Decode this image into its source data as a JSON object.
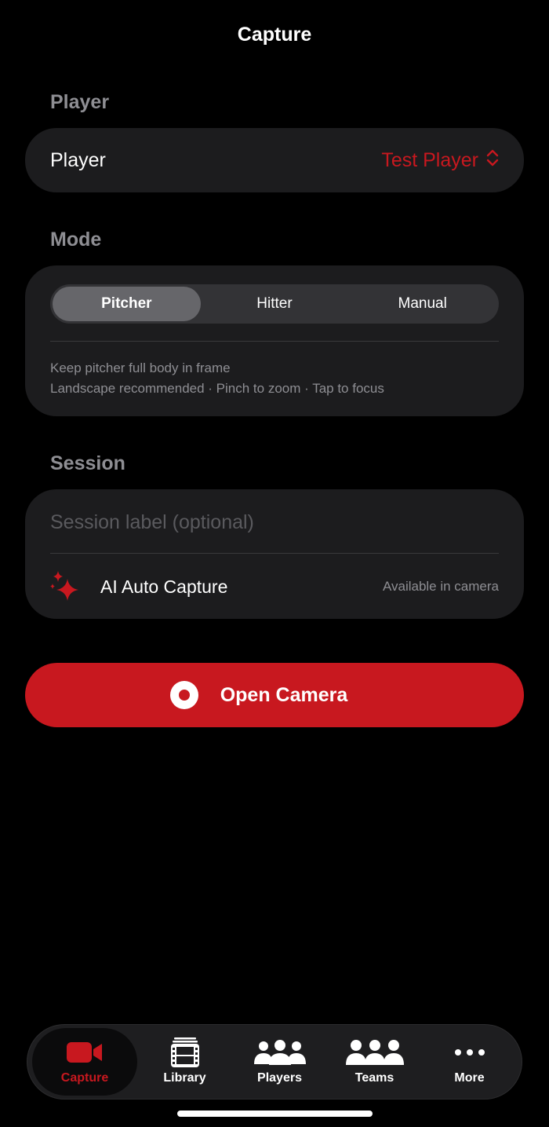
{
  "header": {
    "title": "Capture"
  },
  "player_section": {
    "header": "Player",
    "row_label": "Player",
    "selected_player": "Test Player"
  },
  "mode_section": {
    "header": "Mode",
    "segments": [
      "Pitcher",
      "Hitter",
      "Manual"
    ],
    "selected": "Pitcher",
    "hint_line_1": "Keep pitcher full body in frame",
    "hint_line_2": "Landscape recommended · Pinch to zoom · Tap to focus"
  },
  "session_section": {
    "header": "Session",
    "label_placeholder": "Session label (optional)",
    "label_value": "",
    "ai_label": "AI Auto Capture",
    "ai_status": "Available in camera"
  },
  "primary_action": {
    "label": "Open Camera"
  },
  "tabbar": {
    "items": [
      {
        "label": "Capture",
        "icon": "video-camera-icon",
        "active": true
      },
      {
        "label": "Library",
        "icon": "film-icon",
        "active": false
      },
      {
        "label": "Players",
        "icon": "people-icon",
        "active": false
      },
      {
        "label": "Teams",
        "icon": "people-icon",
        "active": false
      },
      {
        "label": "More",
        "icon": "ellipsis-icon",
        "active": false
      }
    ]
  },
  "colors": {
    "accent": "#c8181f",
    "background": "#000000",
    "card": "#1c1c1e",
    "secondary_text": "#8e8e93"
  }
}
